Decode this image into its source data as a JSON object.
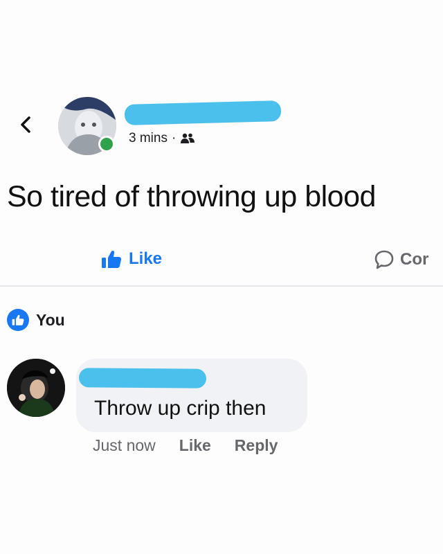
{
  "post": {
    "timestamp": "3 mins",
    "separator": "·",
    "audience_icon": "friends-icon",
    "text": "So tired of throwing up blood",
    "author_name_redacted": true
  },
  "actions": {
    "like_label": "Like",
    "comment_label": "Cor"
  },
  "reactions": {
    "icon": "like-reaction-icon",
    "label": "You"
  },
  "comment": {
    "text": "Throw up crip then",
    "time": "Just now",
    "like_label": "Like",
    "reply_label": "Reply",
    "author_name_redacted": true
  },
  "colors": {
    "brand_blue": "#1877f2",
    "redaction": "#4cc0ec",
    "online": "#31a24c",
    "bubble": "#f0f2f5",
    "muted_text": "#65676b"
  }
}
